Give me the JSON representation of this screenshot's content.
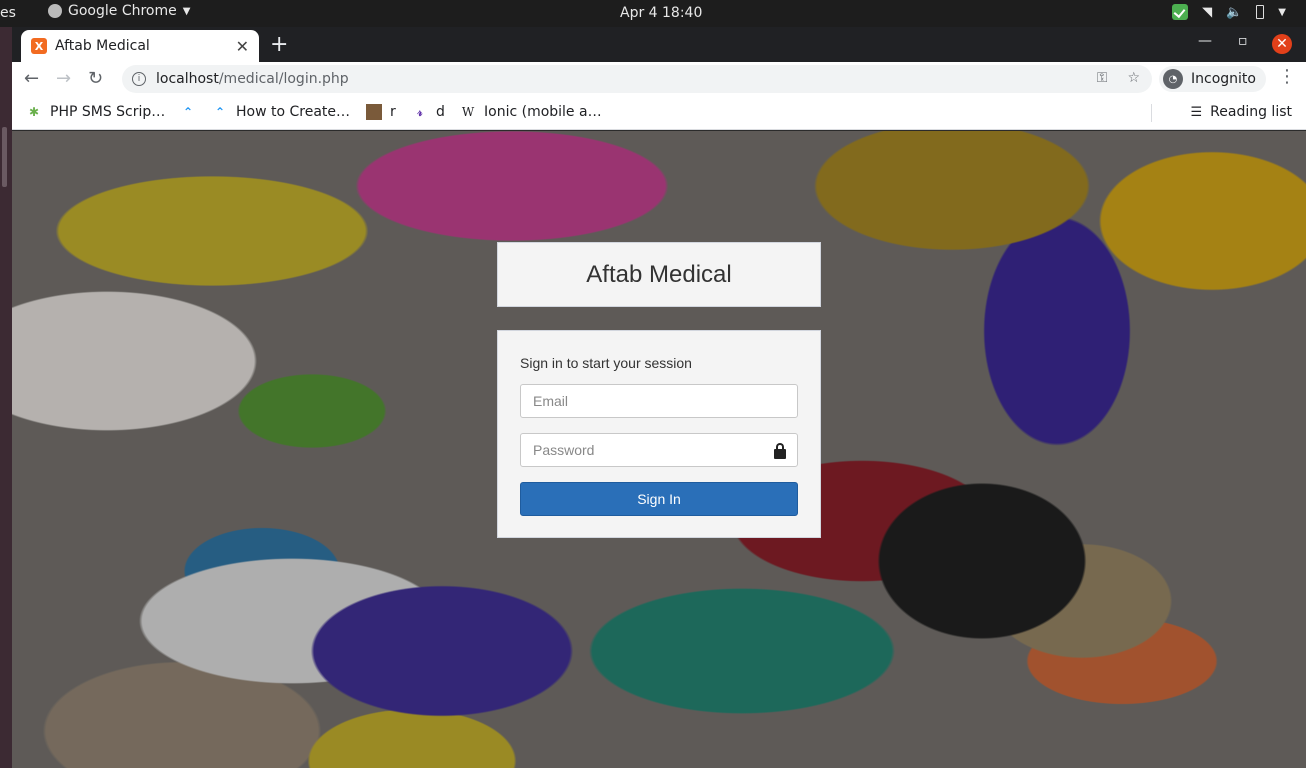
{
  "system": {
    "activities": "es",
    "app_menu": "Google Chrome",
    "clock": "Apr 4  18:40"
  },
  "browser": {
    "tab_title": "Aftab Medical",
    "url_host": "localhost",
    "url_path": "/medical/login.php",
    "profile_label": "Incognito",
    "bookmarks": [
      {
        "label": "PHP SMS Scrip…",
        "icon": "bug-icon"
      },
      {
        "label": "",
        "icon": "pin-icon"
      },
      {
        "label": "How to Create…",
        "icon": "pin-icon"
      },
      {
        "label": "r",
        "icon": "image-icon"
      },
      {
        "label": "d",
        "icon": "r-icon"
      },
      {
        "label": "Ionic (mobile a…",
        "icon": "wikipedia-icon"
      }
    ],
    "reading_list": "Reading list"
  },
  "login": {
    "brand": "Aftab Medical",
    "message": "Sign in to start your session",
    "email_placeholder": "Email",
    "password_placeholder": "Password",
    "submit_label": "Sign In"
  }
}
